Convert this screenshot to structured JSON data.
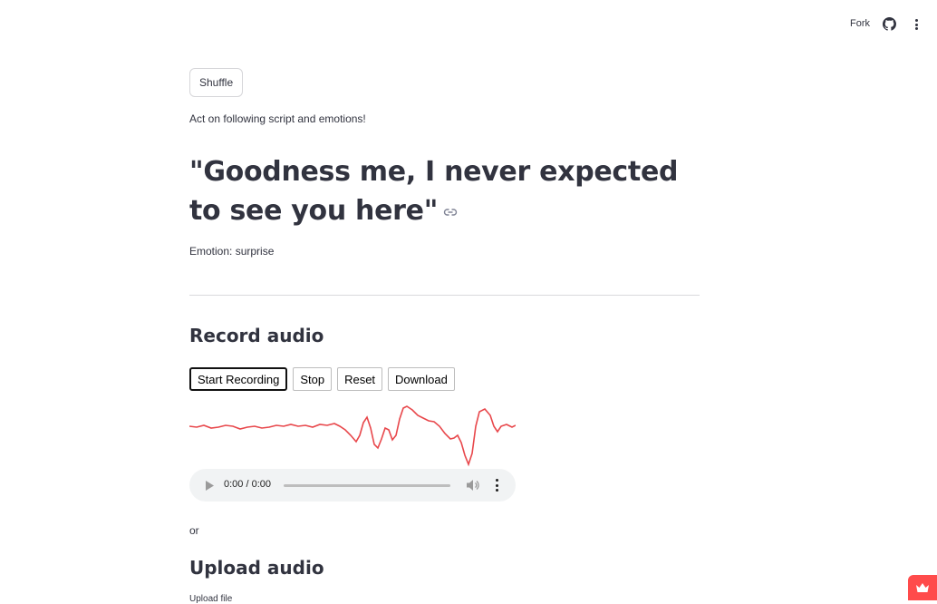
{
  "header": {
    "fork_label": "Fork",
    "github_icon": "github-icon",
    "menu_icon": "kebab-menu-icon"
  },
  "main": {
    "shuffle_label": "Shuffle",
    "instruction": "Act on following script and emotions!",
    "quote": "\"Goodness me, I never expected to see you here\"",
    "emotion": "Emotion: surprise",
    "record_heading": "Record audio",
    "recorder_buttons": {
      "start": "Start Recording",
      "stop": "Stop",
      "reset": "Reset",
      "download": "Download"
    },
    "waveform_color": "#e8474b",
    "audio_player": {
      "time": "0:00 / 0:00"
    },
    "or_label": "or",
    "upload_heading": "Upload audio",
    "upload_label": "Upload file"
  },
  "colors": {
    "text": "#31333f",
    "accent": "#ff4b4b",
    "player_bg": "#f1f3f4"
  }
}
